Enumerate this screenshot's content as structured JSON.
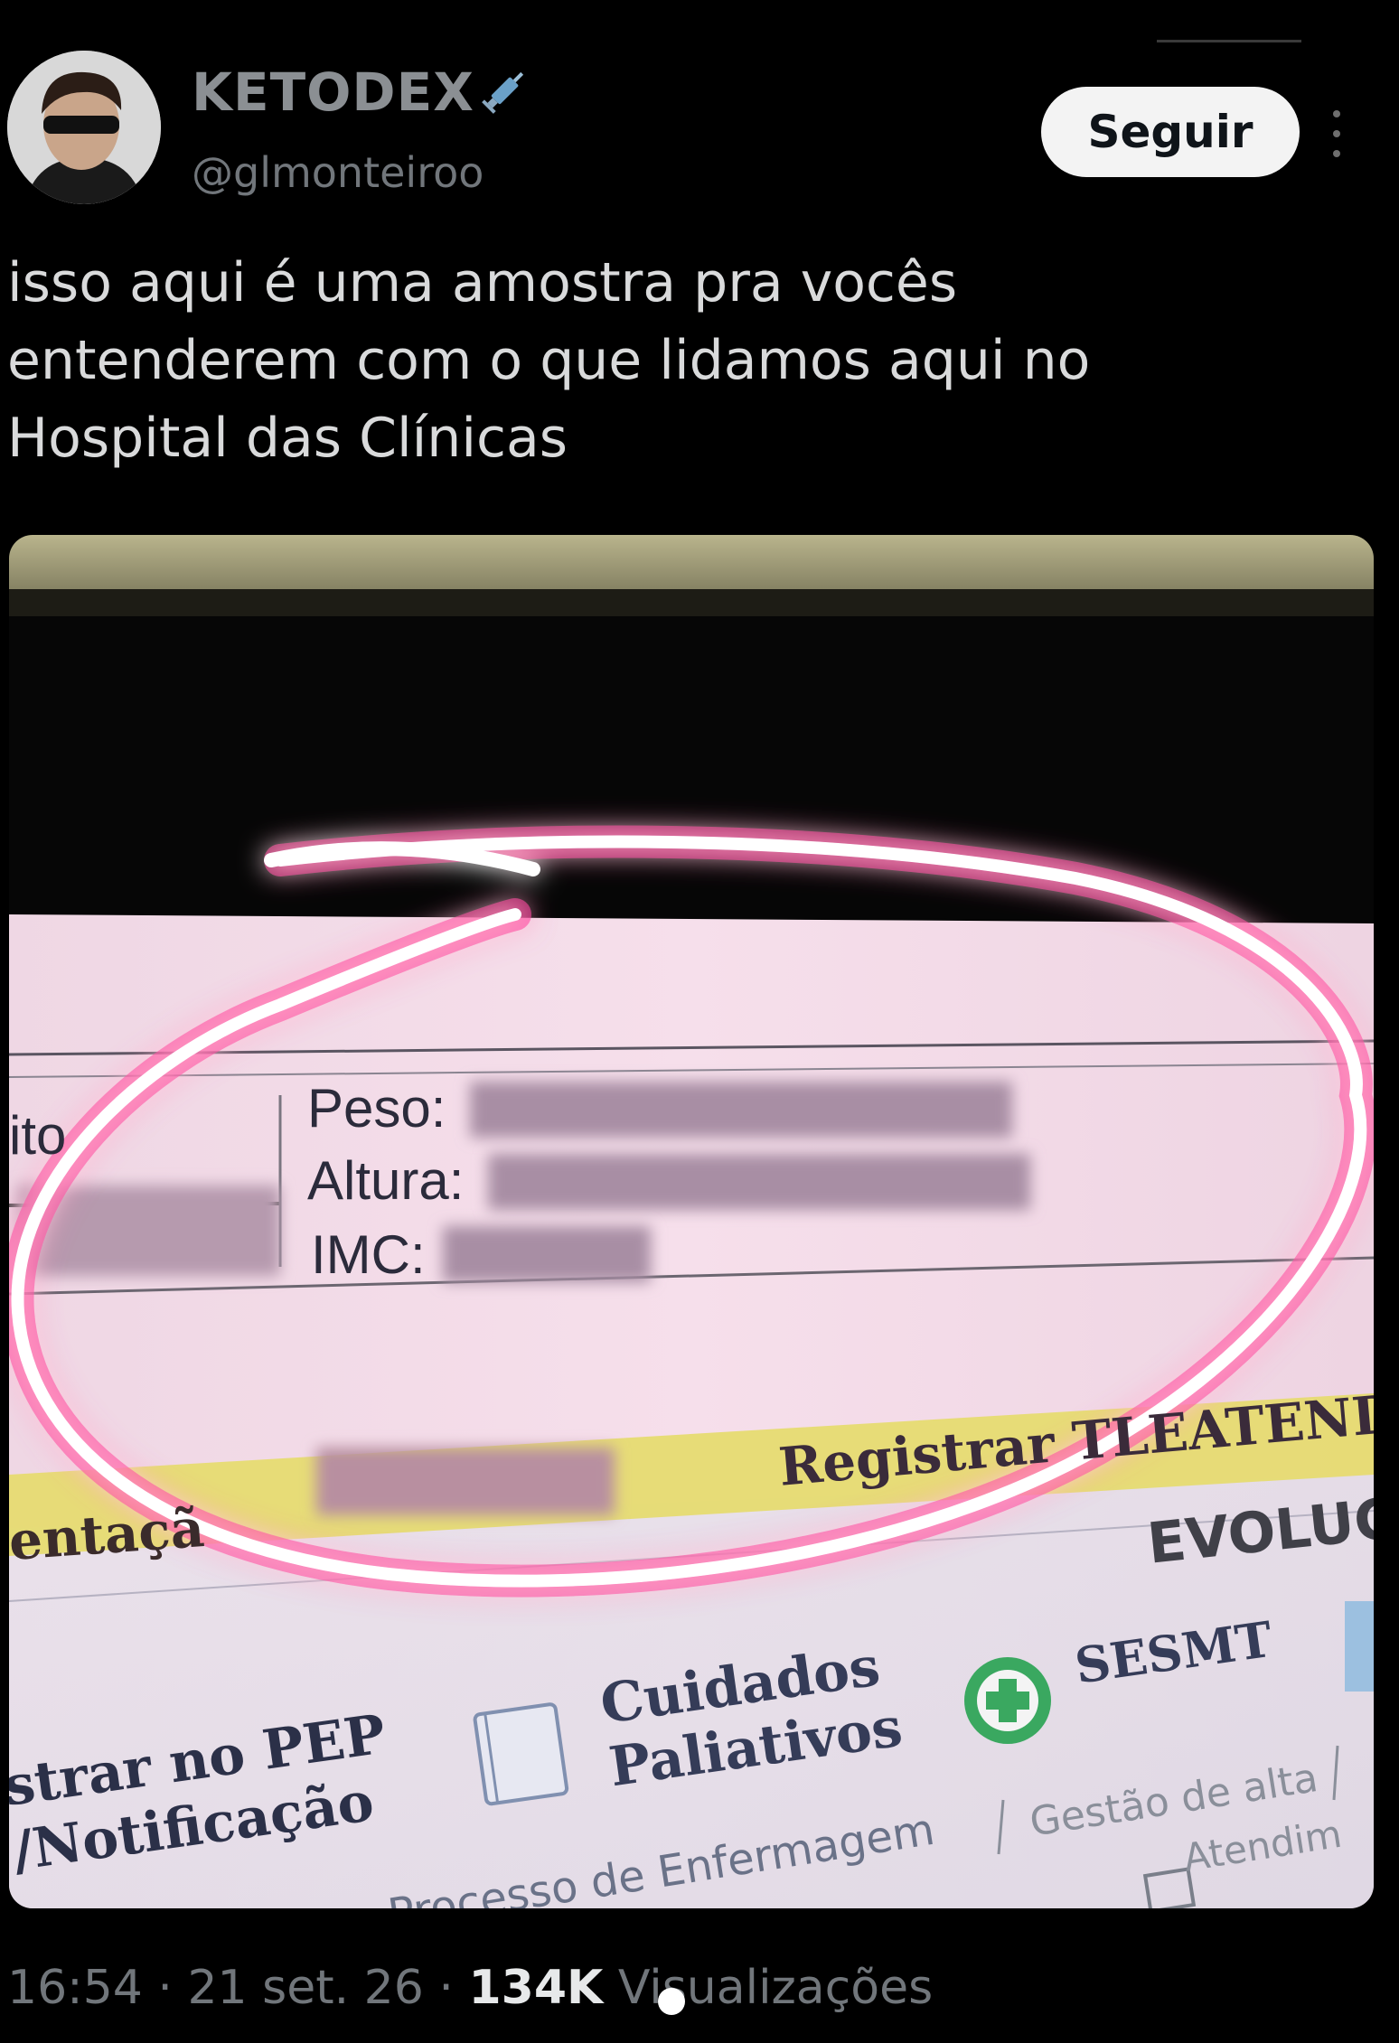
{
  "author": {
    "display_name": "KETODEX",
    "username": "@glmonteiroo",
    "emoji_icon": "syringe-icon"
  },
  "follow_label": "Seguir",
  "tweet_text": "isso aqui é uma amostra pra vocês\nentenderem com o que lidamos aqui no\nHospital das Clínicas",
  "media": {
    "fields": {
      "peso": "Peso:",
      "altura": "Altura:",
      "imc": "IMC:",
      "partial_left": "ito"
    },
    "registrar": "Registrar T",
    "registrar_tail": "LEATENDIM",
    "orientacao_partial": "entaçã",
    "evolucao_partial": "EVOLUÇ",
    "cuidados_line1": "Cuidados",
    "cuidados_line2": "Paliativos",
    "sesmt": "SESMT",
    "pep_line1": "strar no PEP",
    "pep_line2": "/Notificação",
    "processo": "Processo de Enfermagem",
    "gestao": "Gestão de alta",
    "atendim": "Atendim",
    "highlight_color": "#ff2d8e"
  },
  "meta": {
    "time": "16:54",
    "date": "21 set. 26",
    "views_count": "134K",
    "views_label": "Visualizações"
  }
}
